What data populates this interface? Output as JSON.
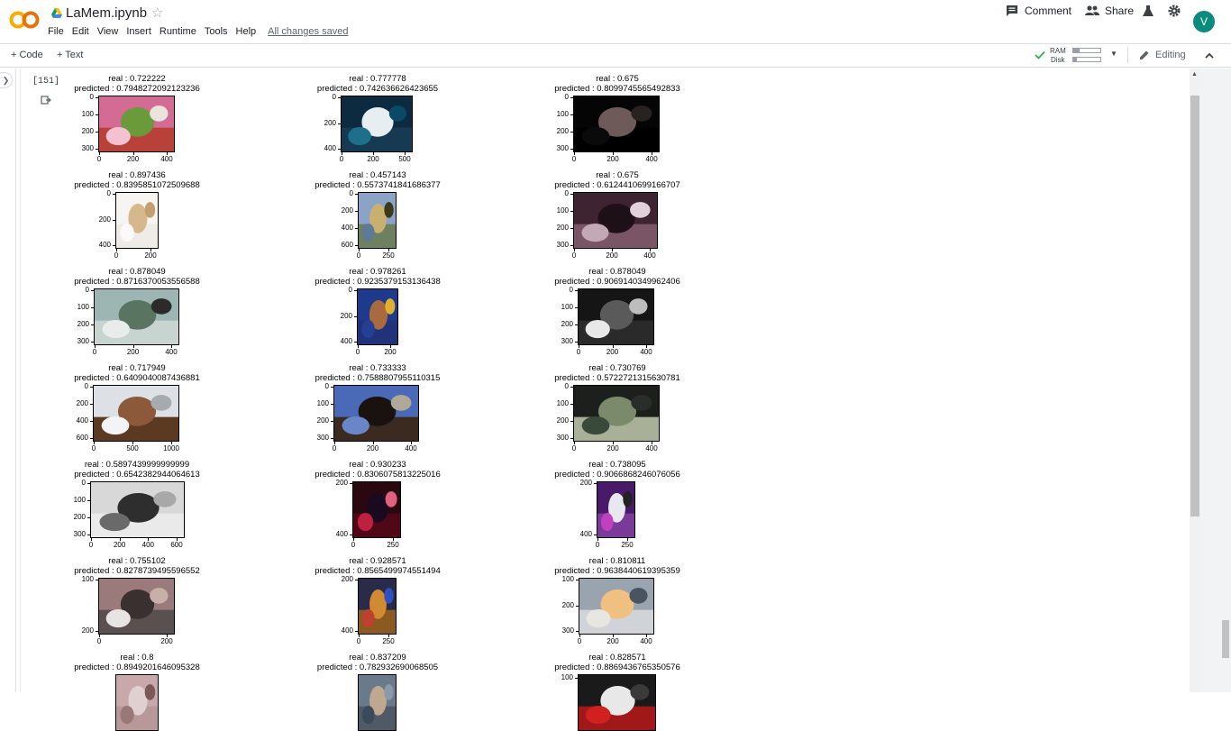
{
  "header": {
    "logo": "CO",
    "title": "LaMem.ipynb",
    "menu": [
      "File",
      "Edit",
      "View",
      "Insert",
      "Runtime",
      "Tools",
      "Help"
    ],
    "saved_status": "All changes saved",
    "comment_label": "Comment",
    "share_label": "Share",
    "avatar_letter": "V"
  },
  "toolbar": {
    "code_label": "+ Code",
    "text_label": "+ Text",
    "ram_label": "RAM",
    "disk_label": "Disk",
    "editing_label": "Editing"
  },
  "cell": {
    "execution_count": "[151]"
  },
  "figure": {
    "subplots": [
      {
        "real": "real : 0.722222",
        "pred": "predicted : 0.7948272092123236",
        "yticks": [
          "0",
          "100",
          "200",
          "300"
        ],
        "xticks": [
          "0",
          "200",
          "400"
        ],
        "palette": [
          "#d46b94",
          "#f2c2d0",
          "#6a9a3a",
          "#e9e5dc",
          "#b8423a"
        ]
      },
      {
        "real": "real : 0.777778",
        "pred": "predicted : 0.742636626423655",
        "yticks": [
          "0",
          "200",
          "400"
        ],
        "xticks": [
          "0",
          "200",
          "500"
        ],
        "palette": [
          "#0c2a40",
          "#1e6f8a",
          "#e6eef2",
          "#0a4a66",
          "#163a52"
        ]
      },
      {
        "real": "real : 0.675",
        "pred": "predicted : 0.8099745565492833",
        "yticks": [
          "0",
          "100",
          "200",
          "300"
        ],
        "xticks": [
          "0",
          "200",
          "400"
        ],
        "palette": [
          "#050505",
          "#0a0a0a",
          "#6e5a58",
          "#2a2222",
          "#000000"
        ]
      },
      {
        "real": "real : 0.897436",
        "pred": "predicted : 0.8395851072509688",
        "yticks": [
          "0",
          "200",
          "400"
        ],
        "xticks": [
          "0",
          "200"
        ],
        "palette": [
          "#f7f5f2",
          "#fbfaf8",
          "#d5b98c",
          "#c4a070",
          "#efece8"
        ]
      },
      {
        "real": "real : 0.457143",
        "pred": "predicted : 0.5573741841686377",
        "yticks": [
          "0",
          "200",
          "400",
          "600"
        ],
        "xticks": [
          "0",
          "250"
        ],
        "palette": [
          "#8ba3c7",
          "#5e7a99",
          "#c9b070",
          "#3a3a1a",
          "#6d8060"
        ]
      },
      {
        "real": "real : 0.675",
        "pred": "predicted : 0.6124410699166707",
        "yticks": [
          "0",
          "100",
          "200",
          "300"
        ],
        "xticks": [
          "0",
          "200",
          "400"
        ],
        "palette": [
          "#3e2330",
          "#c4a8b6",
          "#1d1016",
          "#e2d0da",
          "#7a5566"
        ]
      },
      {
        "real": "real : 0.878049",
        "pred": "predicted : 0.8716370053556588",
        "yticks": [
          "0",
          "100",
          "200",
          "300"
        ],
        "xticks": [
          "0",
          "200",
          "400"
        ],
        "palette": [
          "#9eb6b3",
          "#e8ecea",
          "#5a7462",
          "#2b2b2b",
          "#c8d4cf"
        ]
      },
      {
        "real": "real : 0.978261",
        "pred": "predicted : 0.9235379153136438",
        "yticks": [
          "0",
          "200",
          "400"
        ],
        "xticks": [
          "0",
          "200"
        ],
        "palette": [
          "#1d3a8c",
          "#253f94",
          "#a86a3e",
          "#e0b030",
          "#20337a"
        ]
      },
      {
        "real": "real : 0.878049",
        "pred": "predicted : 0.9069140349962406",
        "yticks": [
          "0",
          "100",
          "200",
          "300"
        ],
        "xticks": [
          "0",
          "200",
          "400"
        ],
        "palette": [
          "#151515",
          "#e8e8e8",
          "#5a5a5a",
          "#bdbdbd",
          "#2a2a2a"
        ]
      },
      {
        "real": "real : 0.717949",
        "pred": "predicted : 0.6409040087436881",
        "yticks": [
          "0",
          "200",
          "400",
          "600"
        ],
        "xticks": [
          "0",
          "500",
          "1000"
        ],
        "palette": [
          "#dde1e6",
          "#f3f4f6",
          "#8c5a3a",
          "#a6abb0",
          "#5c3a22"
        ]
      },
      {
        "real": "real : 0.733333",
        "pred": "predicted : 0.7588807955110315",
        "yticks": [
          "0",
          "100",
          "200",
          "300"
        ],
        "xticks": [
          "0",
          "200",
          "400"
        ],
        "palette": [
          "#4a6ab8",
          "#6a86c8",
          "#1a120e",
          "#b0a898",
          "#3a2a20"
        ]
      },
      {
        "real": "real : 0.730769",
        "pred": "predicted : 0.5722721315630781",
        "yticks": [
          "0",
          "100",
          "200",
          "300"
        ],
        "xticks": [
          "0",
          "200",
          "400"
        ],
        "palette": [
          "#1d1f1d",
          "#3a4a3a",
          "#7a8a6a",
          "#2a2e2a",
          "#a8b098"
        ]
      },
      {
        "real": "real : 0.5897439999999999",
        "pred": "predicted : 0.6542382944064613",
        "yticks": [
          "0",
          "100",
          "200",
          "300"
        ],
        "xticks": [
          "0",
          "200",
          "400",
          "600"
        ],
        "palette": [
          "#d8d8d8",
          "#6a6a6a",
          "#2e2e2e",
          "#a8a8a8",
          "#eaeaea"
        ]
      },
      {
        "real": "real : 0.930233",
        "pred": "predicted : 0.8306075813225016",
        "yticks": [
          "200",
          "400"
        ],
        "xticks": [
          "0",
          "250"
        ],
        "palette": [
          "#2a0810",
          "#c02040",
          "#1a0a20",
          "#e06080",
          "#500818"
        ]
      },
      {
        "real": "real : 0.738095",
        "pred": "predicted : 0.9066868246076056",
        "yticks": [
          "200",
          "400"
        ],
        "xticks": [
          "0",
          "250"
        ],
        "palette": [
          "#4a1a6a",
          "#c040c0",
          "#e8e8f0",
          "#222222",
          "#7a3a9a"
        ]
      },
      {
        "real": "real : 0.755102",
        "pred": "predicted : 0.8278739495596552",
        "yticks": [
          "100",
          "200"
        ],
        "xticks": [
          "0",
          "200"
        ],
        "palette": [
          "#9a7a7a",
          "#e8e4e4",
          "#3a3030",
          "#c8b0a8",
          "#5a5050"
        ]
      },
      {
        "real": "real : 0.928571",
        "pred": "predicted : 0.8565499974551494",
        "yticks": [
          "200",
          "400"
        ],
        "xticks": [
          "0",
          "250"
        ],
        "palette": [
          "#2a2a4a",
          "#c04030",
          "#d08a30",
          "#3050c0",
          "#8a5a20"
        ]
      },
      {
        "real": "real : 0.810811",
        "pred": "predicted : 0.9638440619395359",
        "yticks": [
          "100",
          "200",
          "300"
        ],
        "xticks": [
          "0",
          "200",
          "400"
        ],
        "palette": [
          "#9aa4ae",
          "#e8e6e0",
          "#f0c080",
          "#4a5460",
          "#d0d4d8"
        ]
      },
      {
        "real": "real : 0.8",
        "pred": "predicted : 0.8949201646095328",
        "yticks": [],
        "xticks": [],
        "palette": [
          "#c8a8a8",
          "#9a7878",
          "#e0d0d0",
          "#7a5858",
          "#b89898"
        ]
      },
      {
        "real": "real : 0.837209",
        "pred": "predicted : 0.782932690068505",
        "yticks": [],
        "xticks": [],
        "palette": [
          "#6a7a8a",
          "#3a4a5a",
          "#c0a890",
          "#8a9aaa",
          "#505a66"
        ]
      },
      {
        "real": "real : 0.828571",
        "pred": "predicted : 0.8869436765350576",
        "yticks": [
          "100"
        ],
        "xticks": [],
        "palette": [
          "#1a1a1a",
          "#d02020",
          "#e8e8e8",
          "#3a3a3a",
          "#a01818"
        ]
      }
    ]
  }
}
